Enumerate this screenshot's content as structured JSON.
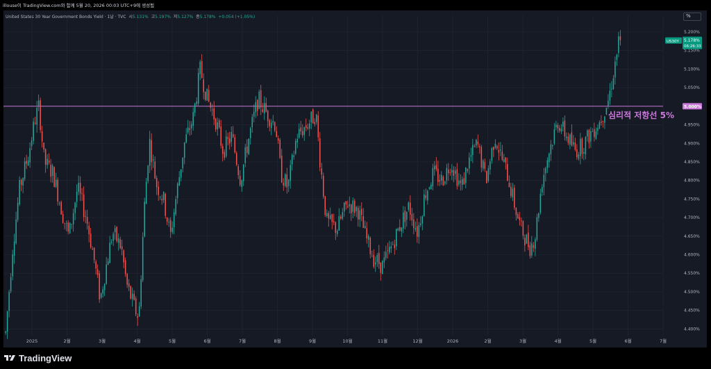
{
  "header": {
    "top_line": "illouse이 TradingView.com와 함께 5월 20, 2026 00:03 UTC+9에 생성됨",
    "legend_name": "United States 30 Year Government Bonds Yield · 1날 · TVC",
    "open_label": "시",
    "open_value": "5.131%",
    "high_label": "고",
    "high_value": "5.197%",
    "low_label": "저",
    "low_value": "5.127%",
    "close_label": "종",
    "close_value": "5.178%",
    "change_value": "+0.054 (+1.05%)",
    "scale_button": "%"
  },
  "footer": {
    "brand": "TradingView",
    "logo_icon": "tradingview-logo-icon"
  },
  "annotation": {
    "text": "심리적 저항선 5%",
    "level": 5.0,
    "color": "#c879d9"
  },
  "price_tag": {
    "symbol": "US30Y",
    "value": "5.178%",
    "countdown": "06:26:33",
    "color": "#089981"
  },
  "level_tag": {
    "value": "5.000%"
  },
  "chart_data": {
    "type": "candlestick",
    "title": "United States 30 Year Government Bonds Yield",
    "y_axis": {
      "range": [
        4.38,
        5.23
      ],
      "ticks": [
        "5.200%",
        "5.150%",
        "5.100%",
        "5.050%",
        "5.000%",
        "4.950%",
        "4.900%",
        "4.850%",
        "4.800%",
        "4.750%",
        "4.700%",
        "4.650%",
        "4.600%",
        "4.550%",
        "4.500%",
        "4.450%",
        "4.400%"
      ]
    },
    "x_axis": {
      "ticks": [
        {
          "label": "2025",
          "month_index": 0
        },
        {
          "label": "2월",
          "month_index": 1
        },
        {
          "label": "3월",
          "month_index": 2
        },
        {
          "label": "4월",
          "month_index": 3
        },
        {
          "label": "5월",
          "month_index": 4
        },
        {
          "label": "6월",
          "month_index": 5
        },
        {
          "label": "7월",
          "month_index": 6
        },
        {
          "label": "8월",
          "month_index": 7
        },
        {
          "label": "9월",
          "month_index": 8
        },
        {
          "label": "10월",
          "month_index": 9
        },
        {
          "label": "11월",
          "month_index": 10
        },
        {
          "label": "12월",
          "month_index": 11
        },
        {
          "label": "2026",
          "month_index": 12
        },
        {
          "label": "2월",
          "month_index": 13
        },
        {
          "label": "3월",
          "month_index": 14
        },
        {
          "label": "4월",
          "month_index": 15
        },
        {
          "label": "5월",
          "month_index": 16
        },
        {
          "label": "6월",
          "month_index": 17
        },
        {
          "label": "7월",
          "month_index": 18
        }
      ]
    },
    "colors": {
      "up": "#26a69a",
      "down": "#ef5350",
      "level_line": "#c879d9",
      "grid": "#232733"
    },
    "grid": true,
    "horizontal_level": 5.0,
    "path_points": [
      [
        -0.75,
        4.39
      ],
      [
        -0.55,
        4.62
      ],
      [
        -0.35,
        4.78
      ],
      [
        -0.1,
        4.87
      ],
      [
        0.1,
        4.97
      ],
      [
        0.2,
        5.0
      ],
      [
        0.35,
        4.85
      ],
      [
        0.6,
        4.82
      ],
      [
        0.9,
        4.7
      ],
      [
        1.05,
        4.65
      ],
      [
        1.3,
        4.78
      ],
      [
        1.55,
        4.7
      ],
      [
        1.75,
        4.6
      ],
      [
        1.95,
        4.48
      ],
      [
        2.1,
        4.56
      ],
      [
        2.3,
        4.66
      ],
      [
        2.55,
        4.62
      ],
      [
        2.7,
        4.52
      ],
      [
        2.95,
        4.45
      ],
      [
        3.05,
        4.43
      ],
      [
        3.2,
        4.72
      ],
      [
        3.35,
        4.91
      ],
      [
        3.55,
        4.79
      ],
      [
        3.75,
        4.75
      ],
      [
        3.95,
        4.65
      ],
      [
        4.15,
        4.78
      ],
      [
        4.35,
        4.9
      ],
      [
        4.6,
        4.97
      ],
      [
        4.8,
        5.1
      ],
      [
        5.0,
        5.02
      ],
      [
        5.25,
        4.96
      ],
      [
        5.45,
        4.88
      ],
      [
        5.7,
        4.92
      ],
      [
        5.95,
        4.8
      ],
      [
        6.15,
        4.9
      ],
      [
        6.45,
        5.02
      ],
      [
        6.7,
        4.98
      ],
      [
        6.95,
        4.95
      ],
      [
        7.1,
        4.82
      ],
      [
        7.3,
        4.78
      ],
      [
        7.55,
        4.92
      ],
      [
        7.85,
        4.95
      ],
      [
        8.1,
        4.98
      ],
      [
        8.2,
        4.87
      ],
      [
        8.4,
        4.69
      ],
      [
        8.7,
        4.67
      ],
      [
        9.0,
        4.74
      ],
      [
        9.3,
        4.72
      ],
      [
        9.55,
        4.64
      ],
      [
        9.75,
        4.59
      ],
      [
        10.0,
        4.57
      ],
      [
        10.25,
        4.62
      ],
      [
        10.5,
        4.68
      ],
      [
        10.75,
        4.73
      ],
      [
        11.0,
        4.66
      ],
      [
        11.2,
        4.76
      ],
      [
        11.45,
        4.82
      ],
      [
        11.7,
        4.8
      ],
      [
        11.95,
        4.85
      ],
      [
        12.25,
        4.78
      ],
      [
        12.45,
        4.85
      ],
      [
        12.7,
        4.9
      ],
      [
        12.95,
        4.8
      ],
      [
        13.2,
        4.92
      ],
      [
        13.4,
        4.86
      ],
      [
        13.55,
        4.82
      ],
      [
        13.8,
        4.72
      ],
      [
        13.95,
        4.67
      ],
      [
        14.2,
        4.62
      ],
      [
        14.35,
        4.65
      ],
      [
        14.55,
        4.8
      ],
      [
        14.75,
        4.88
      ],
      [
        15.0,
        4.96
      ],
      [
        15.25,
        4.92
      ],
      [
        15.5,
        4.88
      ],
      [
        15.75,
        4.9
      ],
      [
        15.95,
        4.93
      ],
      [
        16.2,
        4.96
      ],
      [
        16.45,
        5.02
      ],
      [
        16.6,
        5.1
      ],
      [
        16.75,
        5.18
      ],
      [
        16.78,
        5.178
      ]
    ],
    "candle_count": 355,
    "last_close": 5.178
  }
}
